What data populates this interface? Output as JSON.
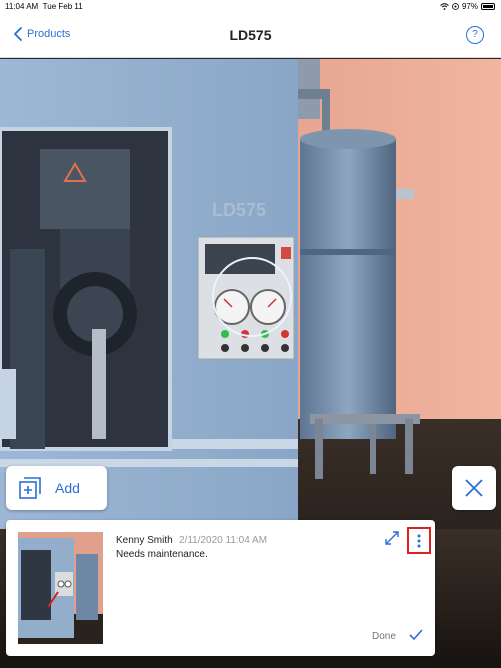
{
  "status_bar": {
    "time": "11:04 AM",
    "date": "Tue Feb 11",
    "battery": "97%"
  },
  "nav": {
    "back_label": "Products",
    "title": "LD575",
    "help_symbol": "?"
  },
  "scene": {
    "machine_label": "LD575"
  },
  "add_button": {
    "label": "Add"
  },
  "note": {
    "author": "Kenny Smith",
    "timestamp": "2/11/2020 11:04 AM",
    "message": "Needs maintenance.",
    "done_label": "Done"
  },
  "icons": {
    "back": "chevron-left-icon",
    "help": "help-icon",
    "add": "add-note-icon",
    "close": "close-icon",
    "expand": "expand-icon",
    "more": "more-vertical-icon",
    "done": "checkmark-icon"
  },
  "colors": {
    "accent": "#2a6fd6",
    "highlight": "#e02020",
    "wall": "#e8a894",
    "machine": "#8da8c6"
  }
}
